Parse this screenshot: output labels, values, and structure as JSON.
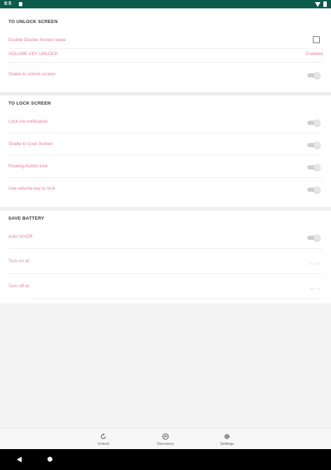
{
  "status_bar": {
    "time": "8:5"
  },
  "sections": {
    "unlock": {
      "header": "TO UNLOCK SCREEN",
      "double_tap": {
        "label": "Double Double Screen wake"
      },
      "volume_key": {
        "label": "VOLUME KEY UNLOCK",
        "value": "Enabled"
      },
      "shake": {
        "label": "Shake to unlock screen"
      }
    },
    "lock": {
      "header": "TO LOCK SCREEN",
      "lock_via_notification": {
        "label": "Lock via notification"
      },
      "shake_to_lock": {
        "label": "Shake to Lock Screen"
      },
      "floating_button": {
        "label": "Floating button lock"
      },
      "volume_key_lock": {
        "label": "Use volume key to lock"
      }
    },
    "battery": {
      "header": "SAVE BATTERY",
      "auto_on_off": {
        "label": "Auto On/Off"
      },
      "turn_on_at": {
        "label": "Turn on at",
        "value": "-- : --"
      },
      "turn_off_at": {
        "label": "Turn off at",
        "value": "-- : --"
      }
    }
  },
  "bottom_nav": {
    "items": [
      {
        "label": "Unlock",
        "icon": "refresh-icon"
      },
      {
        "label": "Discovery",
        "icon": "discovery-icon"
      },
      {
        "label": "Settings",
        "icon": "gear-icon"
      }
    ]
  },
  "colors": {
    "status_bar": "#0d5b4c",
    "label_pink": "#e57a97",
    "background": "#f3f3f3"
  }
}
